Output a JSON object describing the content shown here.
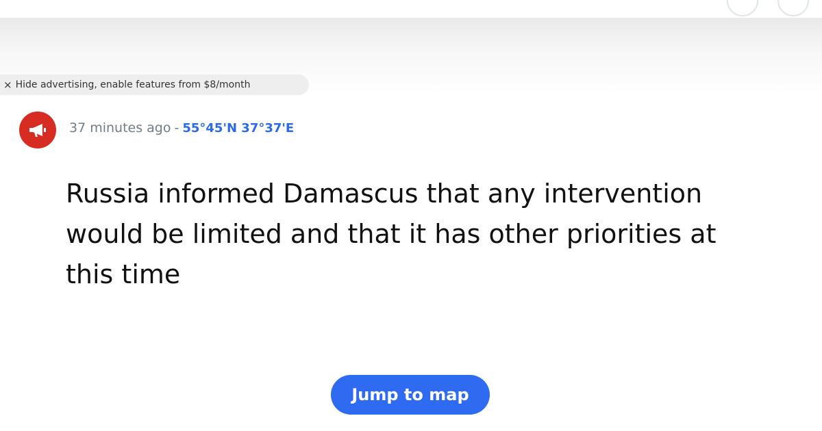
{
  "ad_banner": {
    "close_glyph": "×",
    "text": "Hide advertising, enable features from $8/month"
  },
  "post": {
    "icon": "megaphone-icon",
    "icon_color": "#d72c22",
    "time_ago": "37 minutes ago",
    "separator": "-",
    "coordinates": "55°45'N 37°37'E",
    "headline": "Russia informed Damascus that any intervention would be limited and that it has other priorities at this time"
  },
  "actions": {
    "jump_label": "Jump to map"
  },
  "colors": {
    "accent": "#2f6bf0",
    "coords": "#2d6ae8",
    "meta_text": "#6f7d8a"
  }
}
